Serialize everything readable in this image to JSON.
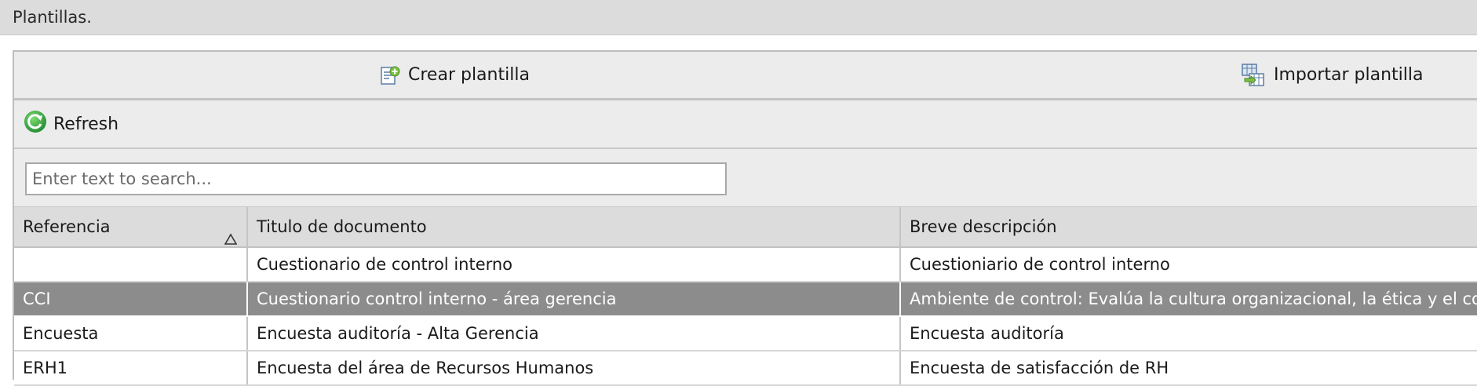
{
  "window": {
    "title": "Plantillas."
  },
  "toolbar": {
    "create_label": "Crear plantilla",
    "import_label": "Importar plantilla",
    "refresh_label": "Refresh",
    "create_icon": "add-document-icon",
    "import_icon": "import-table-icon",
    "refresh_icon": "refresh-icon"
  },
  "search": {
    "placeholder": "Enter text to search...",
    "value": ""
  },
  "table": {
    "columns": [
      {
        "label": "Referencia",
        "sort": "ascending"
      },
      {
        "label": "Titulo de documento"
      },
      {
        "label": "Breve descripción"
      }
    ],
    "rows": [
      {
        "ref": "",
        "title": "Cuestionario de control interno",
        "desc": "Cuestioniario de control interno",
        "selected": false
      },
      {
        "ref": "CCI",
        "title": "Cuestionario control interno - área gerencia",
        "desc": "Ambiente de control: Evalúa la cultura organizacional, la ética y el co",
        "selected": true
      },
      {
        "ref": "Encuesta",
        "title": "Encuesta auditoría - Alta Gerencia",
        "desc": "Encuesta auditoría",
        "selected": false
      },
      {
        "ref": "ERH1",
        "title": "Encuesta del área de Recursos Humanos",
        "desc": "Encuesta de satisfacción de RH",
        "selected": false
      }
    ]
  },
  "colors": {
    "selected_row": "#8c8c8c",
    "toolbar_bg": "#ececec",
    "header_bg": "#dcdcdc",
    "refresh_green": "#2e9e3e"
  }
}
